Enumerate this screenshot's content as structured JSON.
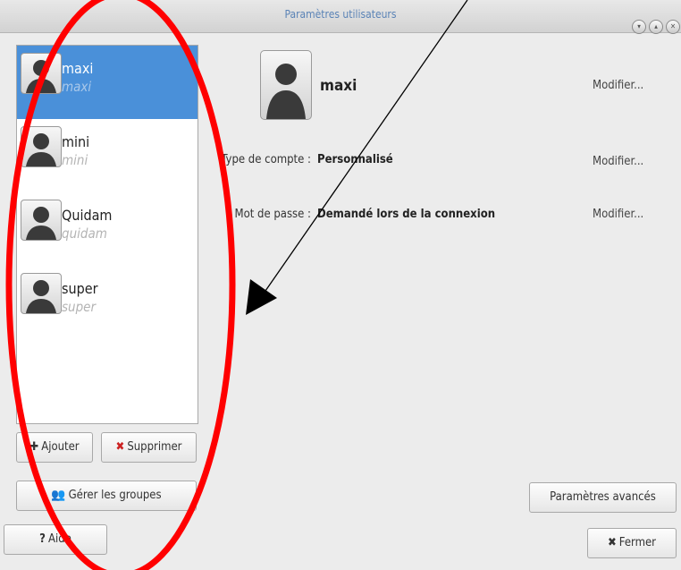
{
  "window": {
    "title": "Paramètres utilisateurs"
  },
  "users": [
    {
      "name": "maxi",
      "login": "maxi",
      "selected": true
    },
    {
      "name": "mini",
      "login": "mini",
      "selected": false
    },
    {
      "name": "Quidam",
      "login": "quidam",
      "selected": false
    },
    {
      "name": "super",
      "login": "super",
      "selected": false
    }
  ],
  "buttons": {
    "add": "Ajouter",
    "remove": "Supprimer",
    "groups": "Gérer les groupes",
    "help": "Aide",
    "advanced": "Paramètres avancés",
    "close": "Fermer"
  },
  "details": {
    "name": "maxi",
    "modify_label": "Modifier...",
    "account_type_label": "Type de compte :",
    "account_type_value": "Personnalisé",
    "password_label": "Mot de passe :",
    "password_value": "Demandé lors de la connexion"
  },
  "annotation": {
    "circle_color": "#ff0000",
    "arrow_color": "#000000"
  }
}
